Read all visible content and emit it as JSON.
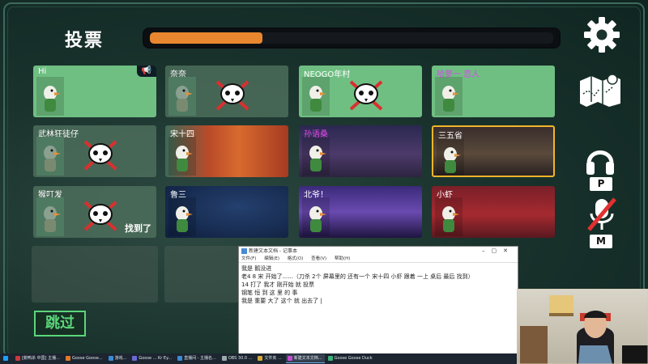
{
  "header": {
    "title": "投票",
    "progress_fraction": 0.28,
    "progress_color": "#e8872f"
  },
  "side_controls": {
    "icons": [
      "gear-icon",
      "map-icon",
      "headphone-icon",
      "mic-muted-icon"
    ],
    "headphone_key": "P",
    "mic_key": "M"
  },
  "players": [
    {
      "name": "Hi",
      "name_color": "#ffffff",
      "state": "alive-speaking",
      "voted": false
    },
    {
      "name": "奈奈",
      "name_color": "#ffffff",
      "state": "dead",
      "voted": true
    },
    {
      "name": "NEOGO年村",
      "name_color": "#ffffff",
      "state": "alive",
      "voted": true
    },
    {
      "name": "哈萝一 恋人",
      "name_color": "#d946ef",
      "state": "alive",
      "voted": false
    },
    {
      "name": "武林狂徒仔",
      "name_color": "#ffffff",
      "state": "dead",
      "voted": true
    },
    {
      "name": "宋十四",
      "name_color": "#ffffff",
      "state": "alive",
      "voted": false
    },
    {
      "name": "孙语桑",
      "name_color": "#e14be6",
      "state": "alive",
      "voted": false
    },
    {
      "name": "三五省",
      "name_color": "#ffffff",
      "state": "alive-highlighted",
      "voted": false
    },
    {
      "name": "猴叮发",
      "name_color": "#ffffff",
      "state": "dead",
      "voted": true,
      "status_text": "找到了"
    },
    {
      "name": "鲁三",
      "name_color": "#ffffff",
      "state": "alive",
      "voted": false
    },
    {
      "name": "北爷！",
      "name_color": "#ffffff",
      "state": "alive",
      "voted": false
    },
    {
      "name": "小虾",
      "name_color": "#ffffff",
      "state": "alive",
      "voted": false
    }
  ],
  "skip_button_label": "跳过",
  "notepad": {
    "title": "新建文本文档 - 记事本",
    "menu": [
      "文件(F)",
      "编辑(E)",
      "格式(O)",
      "查看(V)",
      "帮助(H)"
    ],
    "lines": [
      "我是 鹅没进",
      "老4 8 宋 开始了......（刀杀 2个 屏幕里的 还有一个 宋十四 小虾 跟着 一上 桌后 最后 找到）",
      "14 打了 我才 刚开始 就 投票",
      "钢笔 恒 到 这 里 的 事",
      "我是 重要 大了 这个 就 出去了 |"
    ]
  },
  "taskbar": {
    "items": [
      {
        "label": "[鹅鸭杀 中国] 主播...",
        "color": "#c93b3b"
      },
      {
        "label": "Goose Goose...",
        "color": "#e07a2b"
      },
      {
        "label": "游戏...",
        "color": "#3b8bd6"
      },
      {
        "label": "Goose ... Kr Ey...",
        "color": "#6a6ad6"
      },
      {
        "label": "直播间 - 主播名...",
        "color": "#3b8bd6"
      },
      {
        "label": "OBS 30.0 ...",
        "color": "#9aa"
      },
      {
        "label": "文件夹 ...",
        "color": "#d6a83b"
      },
      {
        "label": "新建文本文档...",
        "color": "#c94bd6"
      },
      {
        "label": "Goose Goose Duck",
        "color": "#3bb37a"
      }
    ]
  },
  "colors": {
    "card_green": "#6fbf82",
    "highlight_border": "#f2b52a",
    "skip_green": "#5cd67a"
  }
}
